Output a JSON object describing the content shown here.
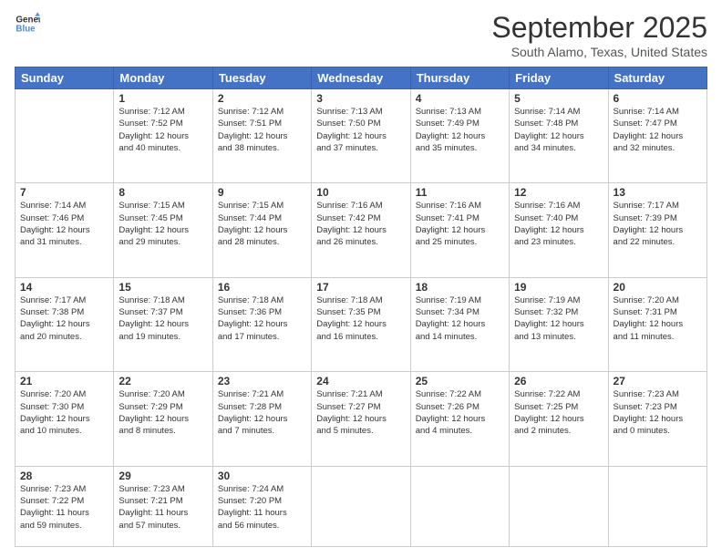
{
  "header": {
    "logo": {
      "line1": "General",
      "line2": "Blue"
    },
    "title": "September 2025",
    "subtitle": "South Alamo, Texas, United States"
  },
  "calendar": {
    "days_of_week": [
      "Sunday",
      "Monday",
      "Tuesday",
      "Wednesday",
      "Thursday",
      "Friday",
      "Saturday"
    ],
    "weeks": [
      [
        {
          "day": "",
          "info": ""
        },
        {
          "day": "1",
          "info": "Sunrise: 7:12 AM\nSunset: 7:52 PM\nDaylight: 12 hours\nand 40 minutes."
        },
        {
          "day": "2",
          "info": "Sunrise: 7:12 AM\nSunset: 7:51 PM\nDaylight: 12 hours\nand 38 minutes."
        },
        {
          "day": "3",
          "info": "Sunrise: 7:13 AM\nSunset: 7:50 PM\nDaylight: 12 hours\nand 37 minutes."
        },
        {
          "day": "4",
          "info": "Sunrise: 7:13 AM\nSunset: 7:49 PM\nDaylight: 12 hours\nand 35 minutes."
        },
        {
          "day": "5",
          "info": "Sunrise: 7:14 AM\nSunset: 7:48 PM\nDaylight: 12 hours\nand 34 minutes."
        },
        {
          "day": "6",
          "info": "Sunrise: 7:14 AM\nSunset: 7:47 PM\nDaylight: 12 hours\nand 32 minutes."
        }
      ],
      [
        {
          "day": "7",
          "info": "Sunrise: 7:14 AM\nSunset: 7:46 PM\nDaylight: 12 hours\nand 31 minutes."
        },
        {
          "day": "8",
          "info": "Sunrise: 7:15 AM\nSunset: 7:45 PM\nDaylight: 12 hours\nand 29 minutes."
        },
        {
          "day": "9",
          "info": "Sunrise: 7:15 AM\nSunset: 7:44 PM\nDaylight: 12 hours\nand 28 minutes."
        },
        {
          "day": "10",
          "info": "Sunrise: 7:16 AM\nSunset: 7:42 PM\nDaylight: 12 hours\nand 26 minutes."
        },
        {
          "day": "11",
          "info": "Sunrise: 7:16 AM\nSunset: 7:41 PM\nDaylight: 12 hours\nand 25 minutes."
        },
        {
          "day": "12",
          "info": "Sunrise: 7:16 AM\nSunset: 7:40 PM\nDaylight: 12 hours\nand 23 minutes."
        },
        {
          "day": "13",
          "info": "Sunrise: 7:17 AM\nSunset: 7:39 PM\nDaylight: 12 hours\nand 22 minutes."
        }
      ],
      [
        {
          "day": "14",
          "info": "Sunrise: 7:17 AM\nSunset: 7:38 PM\nDaylight: 12 hours\nand 20 minutes."
        },
        {
          "day": "15",
          "info": "Sunrise: 7:18 AM\nSunset: 7:37 PM\nDaylight: 12 hours\nand 19 minutes."
        },
        {
          "day": "16",
          "info": "Sunrise: 7:18 AM\nSunset: 7:36 PM\nDaylight: 12 hours\nand 17 minutes."
        },
        {
          "day": "17",
          "info": "Sunrise: 7:18 AM\nSunset: 7:35 PM\nDaylight: 12 hours\nand 16 minutes."
        },
        {
          "day": "18",
          "info": "Sunrise: 7:19 AM\nSunset: 7:34 PM\nDaylight: 12 hours\nand 14 minutes."
        },
        {
          "day": "19",
          "info": "Sunrise: 7:19 AM\nSunset: 7:32 PM\nDaylight: 12 hours\nand 13 minutes."
        },
        {
          "day": "20",
          "info": "Sunrise: 7:20 AM\nSunset: 7:31 PM\nDaylight: 12 hours\nand 11 minutes."
        }
      ],
      [
        {
          "day": "21",
          "info": "Sunrise: 7:20 AM\nSunset: 7:30 PM\nDaylight: 12 hours\nand 10 minutes."
        },
        {
          "day": "22",
          "info": "Sunrise: 7:20 AM\nSunset: 7:29 PM\nDaylight: 12 hours\nand 8 minutes."
        },
        {
          "day": "23",
          "info": "Sunrise: 7:21 AM\nSunset: 7:28 PM\nDaylight: 12 hours\nand 7 minutes."
        },
        {
          "day": "24",
          "info": "Sunrise: 7:21 AM\nSunset: 7:27 PM\nDaylight: 12 hours\nand 5 minutes."
        },
        {
          "day": "25",
          "info": "Sunrise: 7:22 AM\nSunset: 7:26 PM\nDaylight: 12 hours\nand 4 minutes."
        },
        {
          "day": "26",
          "info": "Sunrise: 7:22 AM\nSunset: 7:25 PM\nDaylight: 12 hours\nand 2 minutes."
        },
        {
          "day": "27",
          "info": "Sunrise: 7:23 AM\nSunset: 7:23 PM\nDaylight: 12 hours\nand 0 minutes."
        }
      ],
      [
        {
          "day": "28",
          "info": "Sunrise: 7:23 AM\nSunset: 7:22 PM\nDaylight: 11 hours\nand 59 minutes."
        },
        {
          "day": "29",
          "info": "Sunrise: 7:23 AM\nSunset: 7:21 PM\nDaylight: 11 hours\nand 57 minutes."
        },
        {
          "day": "30",
          "info": "Sunrise: 7:24 AM\nSunset: 7:20 PM\nDaylight: 11 hours\nand 56 minutes."
        },
        {
          "day": "",
          "info": ""
        },
        {
          "day": "",
          "info": ""
        },
        {
          "day": "",
          "info": ""
        },
        {
          "day": "",
          "info": ""
        }
      ]
    ]
  }
}
